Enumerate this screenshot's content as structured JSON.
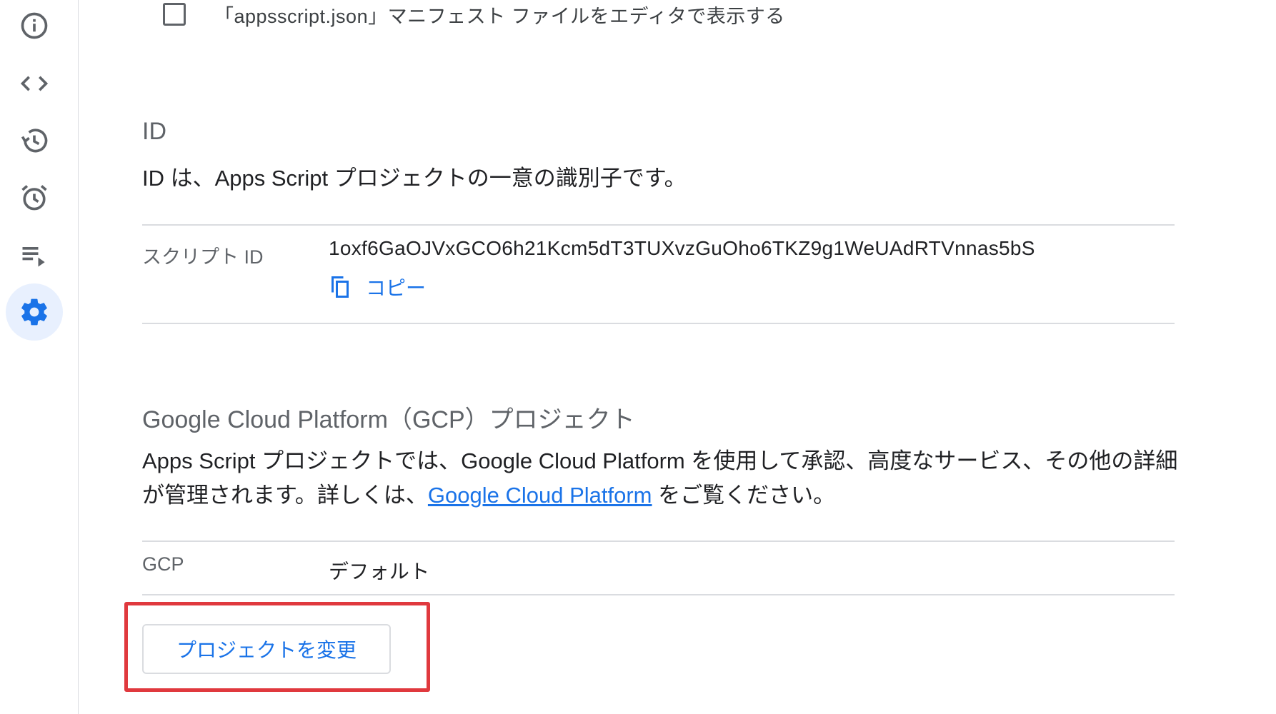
{
  "sidebar": {
    "items": [
      {
        "name": "overview",
        "icon": "info-icon",
        "active": false
      },
      {
        "name": "editor",
        "icon": "code-icon",
        "active": false
      },
      {
        "name": "executions-history",
        "icon": "history-icon",
        "active": false
      },
      {
        "name": "triggers",
        "icon": "alarm-icon",
        "active": false
      },
      {
        "name": "executions",
        "icon": "playlist-play-icon",
        "active": false
      },
      {
        "name": "project-settings",
        "icon": "gear-icon",
        "active": true
      }
    ]
  },
  "manifest": {
    "checkbox_label": "「appsscript.json」マニフェスト ファイルをエディタで表示する",
    "checked": false
  },
  "id_section": {
    "title": "ID",
    "description": "ID は、Apps Script プロジェクトの一意の識別子です。",
    "script_id_label": "スクリプト ID",
    "script_id_value": "1oxf6GaOJVxGCO6h21Kcm5dT3TUXvzGuOho6TKZ9g1WeUAdRTVnnas5bS",
    "copy_label": "コピー"
  },
  "gcp_section": {
    "title": "Google Cloud Platform（GCP）プロジェクト",
    "description_part1": "Apps Script プロジェクトでは、Google Cloud Platform を使用して承認、高度なサービス、その他の詳細が管理されます。詳しくは、",
    "link_text": "Google Cloud Platform",
    "description_part2": " をご覧ください。",
    "gcp_label": "GCP",
    "gcp_value": "デフォルト",
    "change_button_label": "プロジェクトを変更"
  },
  "colors": {
    "accent": "#1a73e8",
    "highlight": "#e0393e",
    "active_bg": "#e8f0fe"
  }
}
